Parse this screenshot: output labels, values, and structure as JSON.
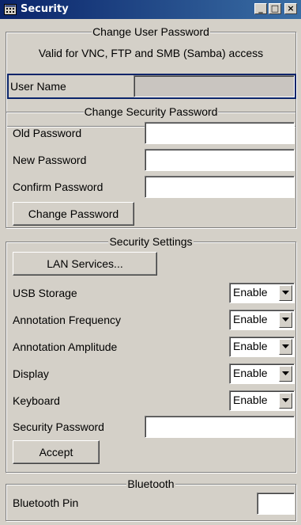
{
  "window": {
    "title": "Security",
    "buttons": {
      "minimize": "_",
      "maximize": "□",
      "close": "×"
    }
  },
  "user_password": {
    "legend": "Change User Password",
    "note": "Valid for VNC, FTP and SMB (Samba) access",
    "user_name_label": "User Name",
    "user_name_value": ""
  },
  "security_password": {
    "legend": "Change Security Password",
    "old_label": "Old Password",
    "new_label": "New Password",
    "confirm_label": "Confirm Password",
    "old_value": "",
    "new_value": "",
    "confirm_value": "",
    "change_button": "Change Password"
  },
  "security_settings": {
    "legend": "Security Settings",
    "lan_button": "LAN Services...",
    "rows": [
      {
        "label": "USB Storage",
        "value": "Enable"
      },
      {
        "label": "Annotation Frequency",
        "value": "Enable"
      },
      {
        "label": "Annotation Amplitude",
        "value": "Enable"
      },
      {
        "label": "Display",
        "value": "Enable"
      },
      {
        "label": "Keyboard",
        "value": "Enable"
      }
    ],
    "password_label": "Security Password",
    "password_value": "",
    "accept_button": "Accept"
  },
  "bluetooth": {
    "legend": "Bluetooth",
    "pin_label": "Bluetooth Pin",
    "pin_value": ""
  },
  "icons": {
    "title_icon": "window-app-icon",
    "dropdown": "chevron-down-icon"
  }
}
